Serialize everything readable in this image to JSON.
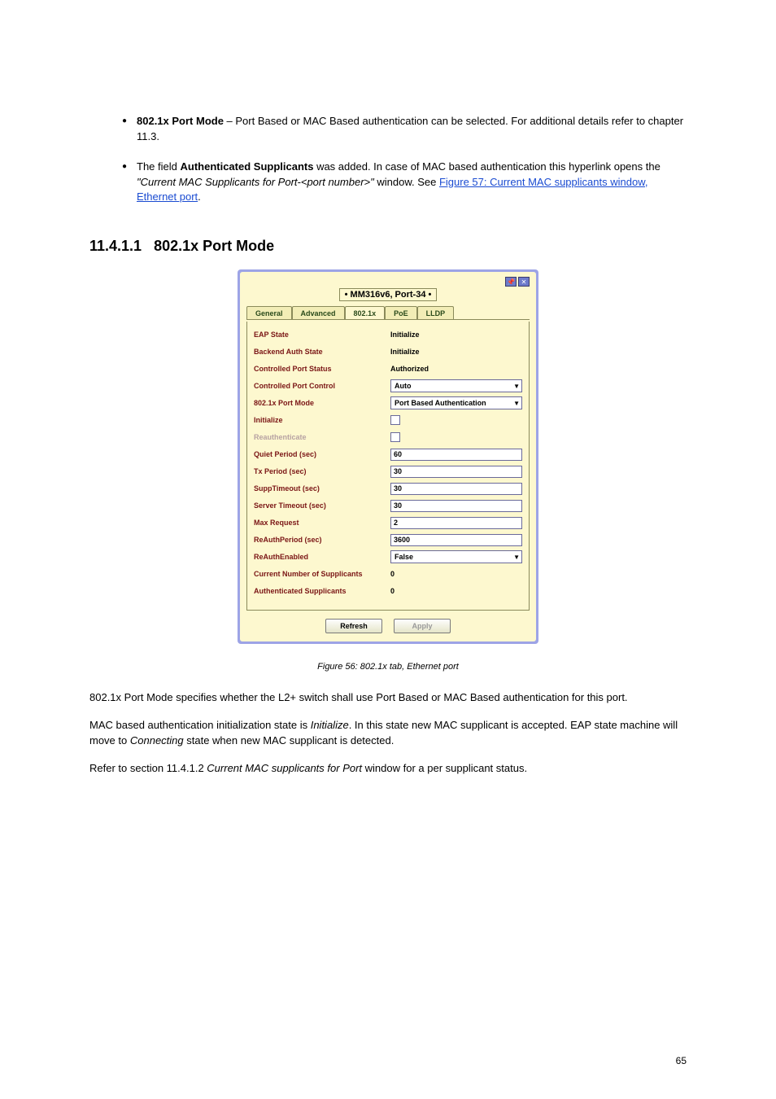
{
  "bullets": {
    "b1_bold": "802.1x Port Mode",
    "b1_text": " – Port Based or MAC Based authentication can be selected. For additional details refer to chapter 11.3.",
    "b2_text_prefix": "The field ",
    "b2_bold": "Authenticated Supplicants",
    "b2_text_mid": " was added. In case of MAC based authentication this hyperlink opens the ",
    "b2_ital1": "\"Current MAC Supplicants for Port-<port number>\"",
    "b2_text_mid2": " window. See ",
    "b2_link": "Figure 57: Current MAC supplicants window, Ethernet port",
    "b2_text_end": "."
  },
  "section": {
    "num": "11.4.1.1",
    "title": "802.1x Port Mode"
  },
  "dialog": {
    "devname": "• MM316v6, Port-34 •",
    "tabs": {
      "t1": "General",
      "t2": "Advanced",
      "t3": "802.1x",
      "t4": "PoE",
      "t5": "LLDP"
    },
    "rows": {
      "eap_state_lbl": "EAP State",
      "eap_state_val": "Initialize",
      "backend_lbl": "Backend Auth State",
      "backend_val": "Initialize",
      "cps_lbl": "Controlled Port Status",
      "cps_val": "Authorized",
      "cpc_lbl": "Controlled Port Control",
      "cpc_val": "Auto",
      "pm_lbl": "802.1x Port Mode",
      "pm_val": "Port Based Authentication",
      "init_lbl": "Initialize",
      "reauth_lbl": "Reauthenticate",
      "qp_lbl": "Quiet Period (sec)",
      "qp_val": "60",
      "tx_lbl": "Tx Period (sec)",
      "tx_val": "30",
      "st_lbl": "SuppTimeout (sec)",
      "st_val": "30",
      "srv_lbl": "Server Timeout (sec)",
      "srv_val": "30",
      "mr_lbl": "Max Request",
      "mr_val": "2",
      "rap_lbl": "ReAuthPeriod (sec)",
      "rap_val": "3600",
      "rae_lbl": "ReAuthEnabled",
      "rae_val": "False",
      "cns_lbl": "Current Number of Supplicants",
      "cns_val": "0",
      "as_lbl": "Authenticated Supplicants",
      "as_val": "0"
    },
    "buttons": {
      "refresh": "Refresh",
      "apply": "Apply"
    }
  },
  "caption": "Figure 56: 802.1x tab, Ethernet port",
  "paras": {
    "p1": "802.1x Port Mode specifies whether the L2+ switch shall use Port Based or MAC Based authentication for this port.",
    "p2_a": "MAC based authentication initialization state is ",
    "p2_b": "Initialize",
    "p2_c": ". In this state new MAC supplicant is accepted. EAP state machine will move to ",
    "p2_d": "Connecting",
    "p2_e": " state when new MAC supplicant is detected.",
    "p3_a": "Refer to section 11.4.1.2 ",
    "p3_b": "Current MAC supplicants for Port",
    "p3_c": " window for a per supplicant status."
  },
  "footer": {
    "page": "65"
  }
}
